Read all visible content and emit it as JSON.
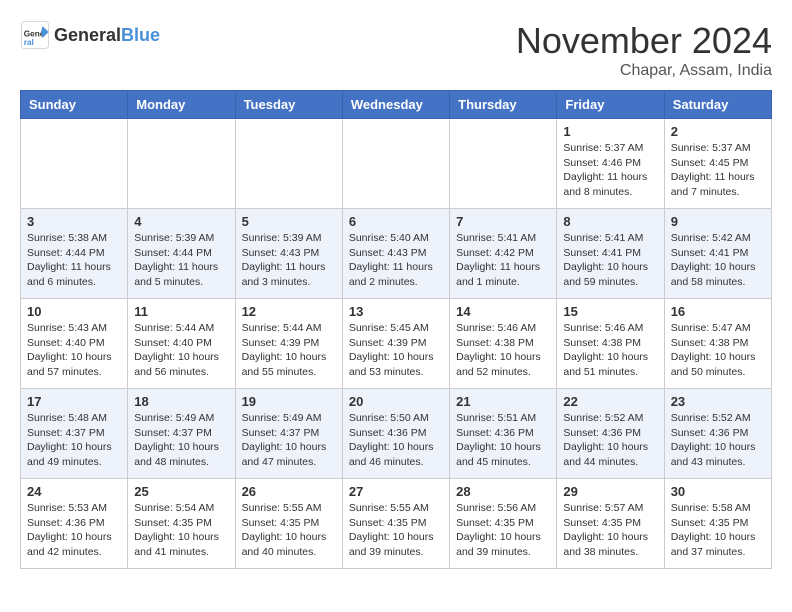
{
  "header": {
    "logo_general": "General",
    "logo_blue": "Blue",
    "month_year": "November 2024",
    "location": "Chapar, Assam, India"
  },
  "days_of_week": [
    "Sunday",
    "Monday",
    "Tuesday",
    "Wednesday",
    "Thursday",
    "Friday",
    "Saturday"
  ],
  "weeks": [
    [
      {
        "day": "",
        "info": ""
      },
      {
        "day": "",
        "info": ""
      },
      {
        "day": "",
        "info": ""
      },
      {
        "day": "",
        "info": ""
      },
      {
        "day": "",
        "info": ""
      },
      {
        "day": "1",
        "info": "Sunrise: 5:37 AM\nSunset: 4:46 PM\nDaylight: 11 hours and 8 minutes."
      },
      {
        "day": "2",
        "info": "Sunrise: 5:37 AM\nSunset: 4:45 PM\nDaylight: 11 hours and 7 minutes."
      }
    ],
    [
      {
        "day": "3",
        "info": "Sunrise: 5:38 AM\nSunset: 4:44 PM\nDaylight: 11 hours and 6 minutes."
      },
      {
        "day": "4",
        "info": "Sunrise: 5:39 AM\nSunset: 4:44 PM\nDaylight: 11 hours and 5 minutes."
      },
      {
        "day": "5",
        "info": "Sunrise: 5:39 AM\nSunset: 4:43 PM\nDaylight: 11 hours and 3 minutes."
      },
      {
        "day": "6",
        "info": "Sunrise: 5:40 AM\nSunset: 4:43 PM\nDaylight: 11 hours and 2 minutes."
      },
      {
        "day": "7",
        "info": "Sunrise: 5:41 AM\nSunset: 4:42 PM\nDaylight: 11 hours and 1 minute."
      },
      {
        "day": "8",
        "info": "Sunrise: 5:41 AM\nSunset: 4:41 PM\nDaylight: 10 hours and 59 minutes."
      },
      {
        "day": "9",
        "info": "Sunrise: 5:42 AM\nSunset: 4:41 PM\nDaylight: 10 hours and 58 minutes."
      }
    ],
    [
      {
        "day": "10",
        "info": "Sunrise: 5:43 AM\nSunset: 4:40 PM\nDaylight: 10 hours and 57 minutes."
      },
      {
        "day": "11",
        "info": "Sunrise: 5:44 AM\nSunset: 4:40 PM\nDaylight: 10 hours and 56 minutes."
      },
      {
        "day": "12",
        "info": "Sunrise: 5:44 AM\nSunset: 4:39 PM\nDaylight: 10 hours and 55 minutes."
      },
      {
        "day": "13",
        "info": "Sunrise: 5:45 AM\nSunset: 4:39 PM\nDaylight: 10 hours and 53 minutes."
      },
      {
        "day": "14",
        "info": "Sunrise: 5:46 AM\nSunset: 4:38 PM\nDaylight: 10 hours and 52 minutes."
      },
      {
        "day": "15",
        "info": "Sunrise: 5:46 AM\nSunset: 4:38 PM\nDaylight: 10 hours and 51 minutes."
      },
      {
        "day": "16",
        "info": "Sunrise: 5:47 AM\nSunset: 4:38 PM\nDaylight: 10 hours and 50 minutes."
      }
    ],
    [
      {
        "day": "17",
        "info": "Sunrise: 5:48 AM\nSunset: 4:37 PM\nDaylight: 10 hours and 49 minutes."
      },
      {
        "day": "18",
        "info": "Sunrise: 5:49 AM\nSunset: 4:37 PM\nDaylight: 10 hours and 48 minutes."
      },
      {
        "day": "19",
        "info": "Sunrise: 5:49 AM\nSunset: 4:37 PM\nDaylight: 10 hours and 47 minutes."
      },
      {
        "day": "20",
        "info": "Sunrise: 5:50 AM\nSunset: 4:36 PM\nDaylight: 10 hours and 46 minutes."
      },
      {
        "day": "21",
        "info": "Sunrise: 5:51 AM\nSunset: 4:36 PM\nDaylight: 10 hours and 45 minutes."
      },
      {
        "day": "22",
        "info": "Sunrise: 5:52 AM\nSunset: 4:36 PM\nDaylight: 10 hours and 44 minutes."
      },
      {
        "day": "23",
        "info": "Sunrise: 5:52 AM\nSunset: 4:36 PM\nDaylight: 10 hours and 43 minutes."
      }
    ],
    [
      {
        "day": "24",
        "info": "Sunrise: 5:53 AM\nSunset: 4:36 PM\nDaylight: 10 hours and 42 minutes."
      },
      {
        "day": "25",
        "info": "Sunrise: 5:54 AM\nSunset: 4:35 PM\nDaylight: 10 hours and 41 minutes."
      },
      {
        "day": "26",
        "info": "Sunrise: 5:55 AM\nSunset: 4:35 PM\nDaylight: 10 hours and 40 minutes."
      },
      {
        "day": "27",
        "info": "Sunrise: 5:55 AM\nSunset: 4:35 PM\nDaylight: 10 hours and 39 minutes."
      },
      {
        "day": "28",
        "info": "Sunrise: 5:56 AM\nSunset: 4:35 PM\nDaylight: 10 hours and 39 minutes."
      },
      {
        "day": "29",
        "info": "Sunrise: 5:57 AM\nSunset: 4:35 PM\nDaylight: 10 hours and 38 minutes."
      },
      {
        "day": "30",
        "info": "Sunrise: 5:58 AM\nSunset: 4:35 PM\nDaylight: 10 hours and 37 minutes."
      }
    ]
  ]
}
